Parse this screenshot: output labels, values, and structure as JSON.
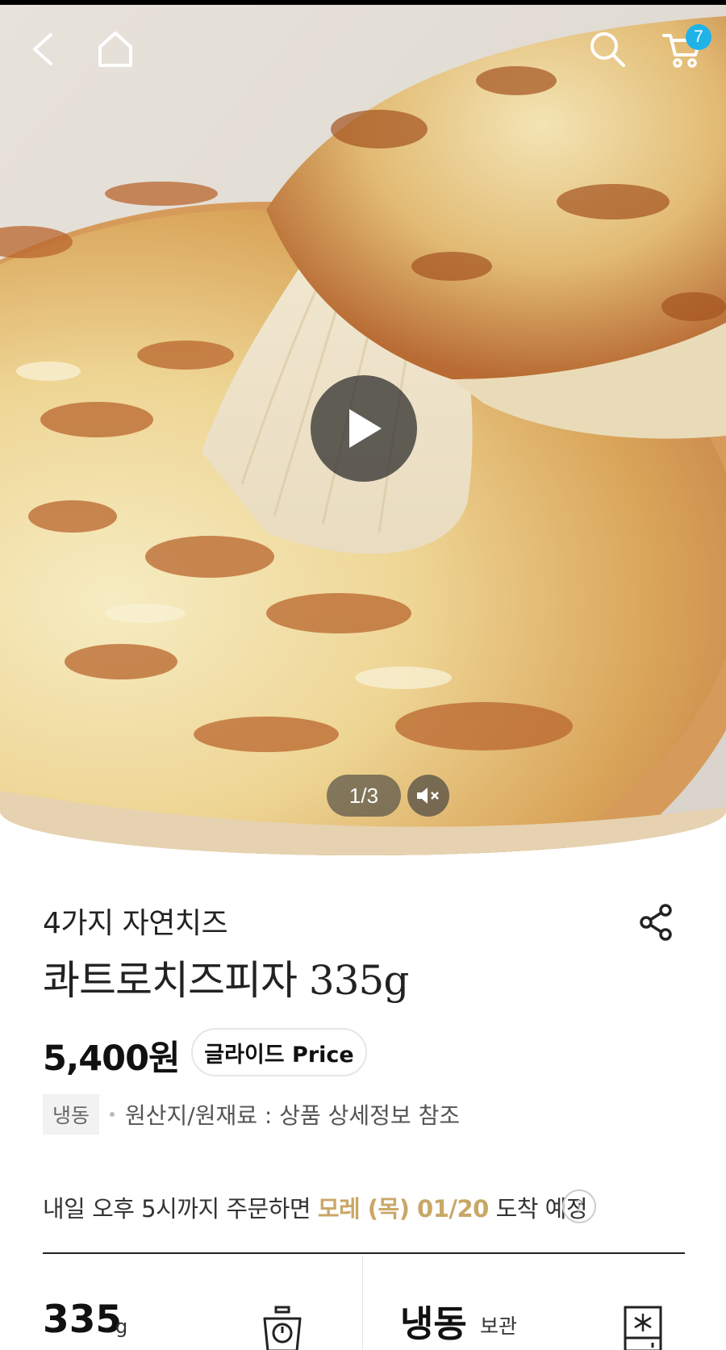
{
  "header": {
    "cart_count": "7"
  },
  "media": {
    "slide_counter": "1/3"
  },
  "product": {
    "subtitle": "4가지 자연치즈",
    "title": "콰트로치즈피자 335g",
    "price": "5,400원",
    "price_badge": "글라이드 Price",
    "storage_tag": "냉동",
    "origin": "원산지/원재료 : 상품 상세정보 참조"
  },
  "delivery": {
    "prefix": "내일 오후 5시까지 주문하면 ",
    "date": "모레 (목) 01/20",
    "suffix": " 도착 예정",
    "help": "?"
  },
  "specs": {
    "weight_value": "335",
    "weight_unit": "g",
    "storage_value": "냉동",
    "storage_sub": "보관"
  },
  "icons": [
    "back-arrow-icon",
    "home-icon",
    "search-icon",
    "cart-icon",
    "play-icon",
    "mute-icon",
    "share-icon",
    "scale-icon",
    "freezer-icon"
  ],
  "colors": {
    "accent_gold": "#c9a766",
    "badge_blue": "#1fb3e8"
  }
}
